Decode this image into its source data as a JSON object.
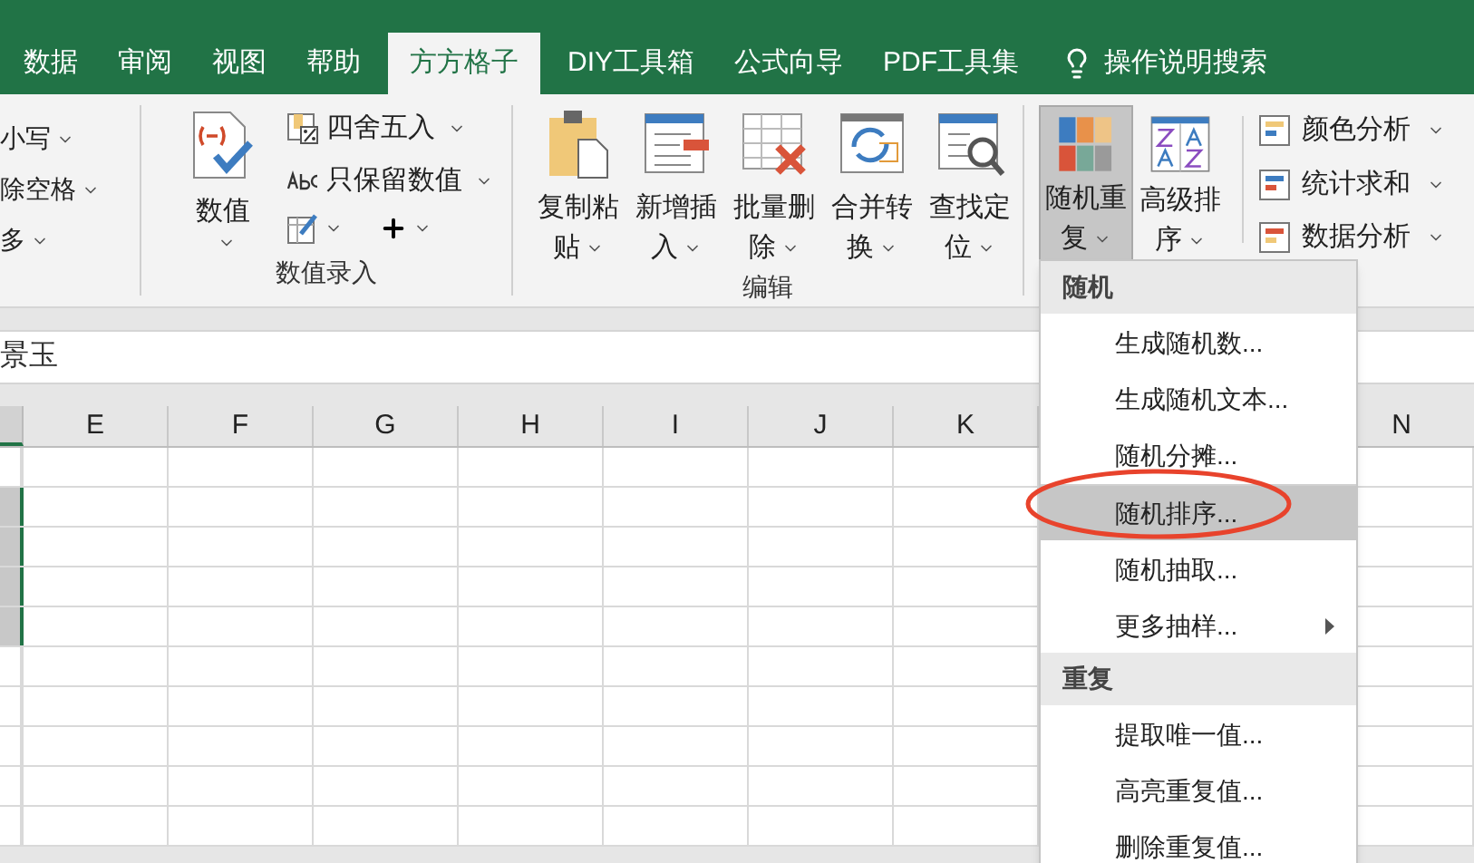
{
  "tabs": [
    {
      "label": "数据",
      "selected": false
    },
    {
      "label": "审阅",
      "selected": false
    },
    {
      "label": "视图",
      "selected": false
    },
    {
      "label": "帮助",
      "selected": false
    },
    {
      "label": "方方格子",
      "selected": true
    },
    {
      "label": "DIY工具箱",
      "selected": false
    },
    {
      "label": "公式向导",
      "selected": false
    },
    {
      "label": "PDF工具集",
      "selected": false
    }
  ],
  "search": {
    "label": "操作说明搜索"
  },
  "ribbon": {
    "text_group": {
      "items": [
        "小写",
        "除空格",
        "多"
      ]
    },
    "number_entry": {
      "label": "数值录入",
      "large_button": "数值",
      "small_buttons": [
        "四舍五入",
        "只保留数值"
      ]
    },
    "edit": {
      "label": "编辑",
      "buttons": [
        "复制粘贴",
        "新增插入",
        "批量删除",
        "合并转换",
        "查找定位"
      ]
    },
    "random": {
      "large_buttons": [
        {
          "label": "随机重复",
          "pressed": true
        },
        {
          "label": "高级排序",
          "pressed": false
        }
      ],
      "small_buttons": [
        "颜色分析",
        "统计求和",
        "数据分析"
      ]
    }
  },
  "formula_bar": {
    "value": "景玉"
  },
  "sheet": {
    "columns": [
      "E",
      "F",
      "G",
      "H",
      "I",
      "J",
      "K",
      "N"
    ],
    "rows": [
      {
        "selected": false
      },
      {
        "selected": true
      },
      {
        "selected": true
      },
      {
        "selected": true
      },
      {
        "selected": true
      },
      {
        "selected": false
      },
      {
        "selected": false
      },
      {
        "selected": false
      },
      {
        "selected": false
      },
      {
        "selected": false
      }
    ]
  },
  "menu": {
    "sections": [
      {
        "title": "随机",
        "items": [
          {
            "label": "生成随机数...",
            "selected": false,
            "separator_above": false,
            "submenu": false
          },
          {
            "label": "生成随机文本...",
            "selected": false,
            "separator_above": false,
            "submenu": false
          },
          {
            "label": "随机分摊...",
            "selected": false,
            "separator_above": false,
            "submenu": false
          },
          {
            "label": "随机排序...",
            "selected": true,
            "separator_above": true,
            "submenu": false
          },
          {
            "label": "随机抽取...",
            "selected": false,
            "separator_above": false,
            "submenu": false
          },
          {
            "label": "更多抽样...",
            "selected": false,
            "separator_above": false,
            "submenu": true
          }
        ]
      },
      {
        "title": "重复",
        "items": [
          {
            "label": "提取唯一值...",
            "selected": false,
            "separator_above": false,
            "submenu": false
          },
          {
            "label": "高亮重复值...",
            "selected": false,
            "separator_above": false,
            "submenu": false
          },
          {
            "label": "删除重复值...",
            "selected": false,
            "separator_above": false,
            "submenu": false
          }
        ]
      }
    ]
  }
}
